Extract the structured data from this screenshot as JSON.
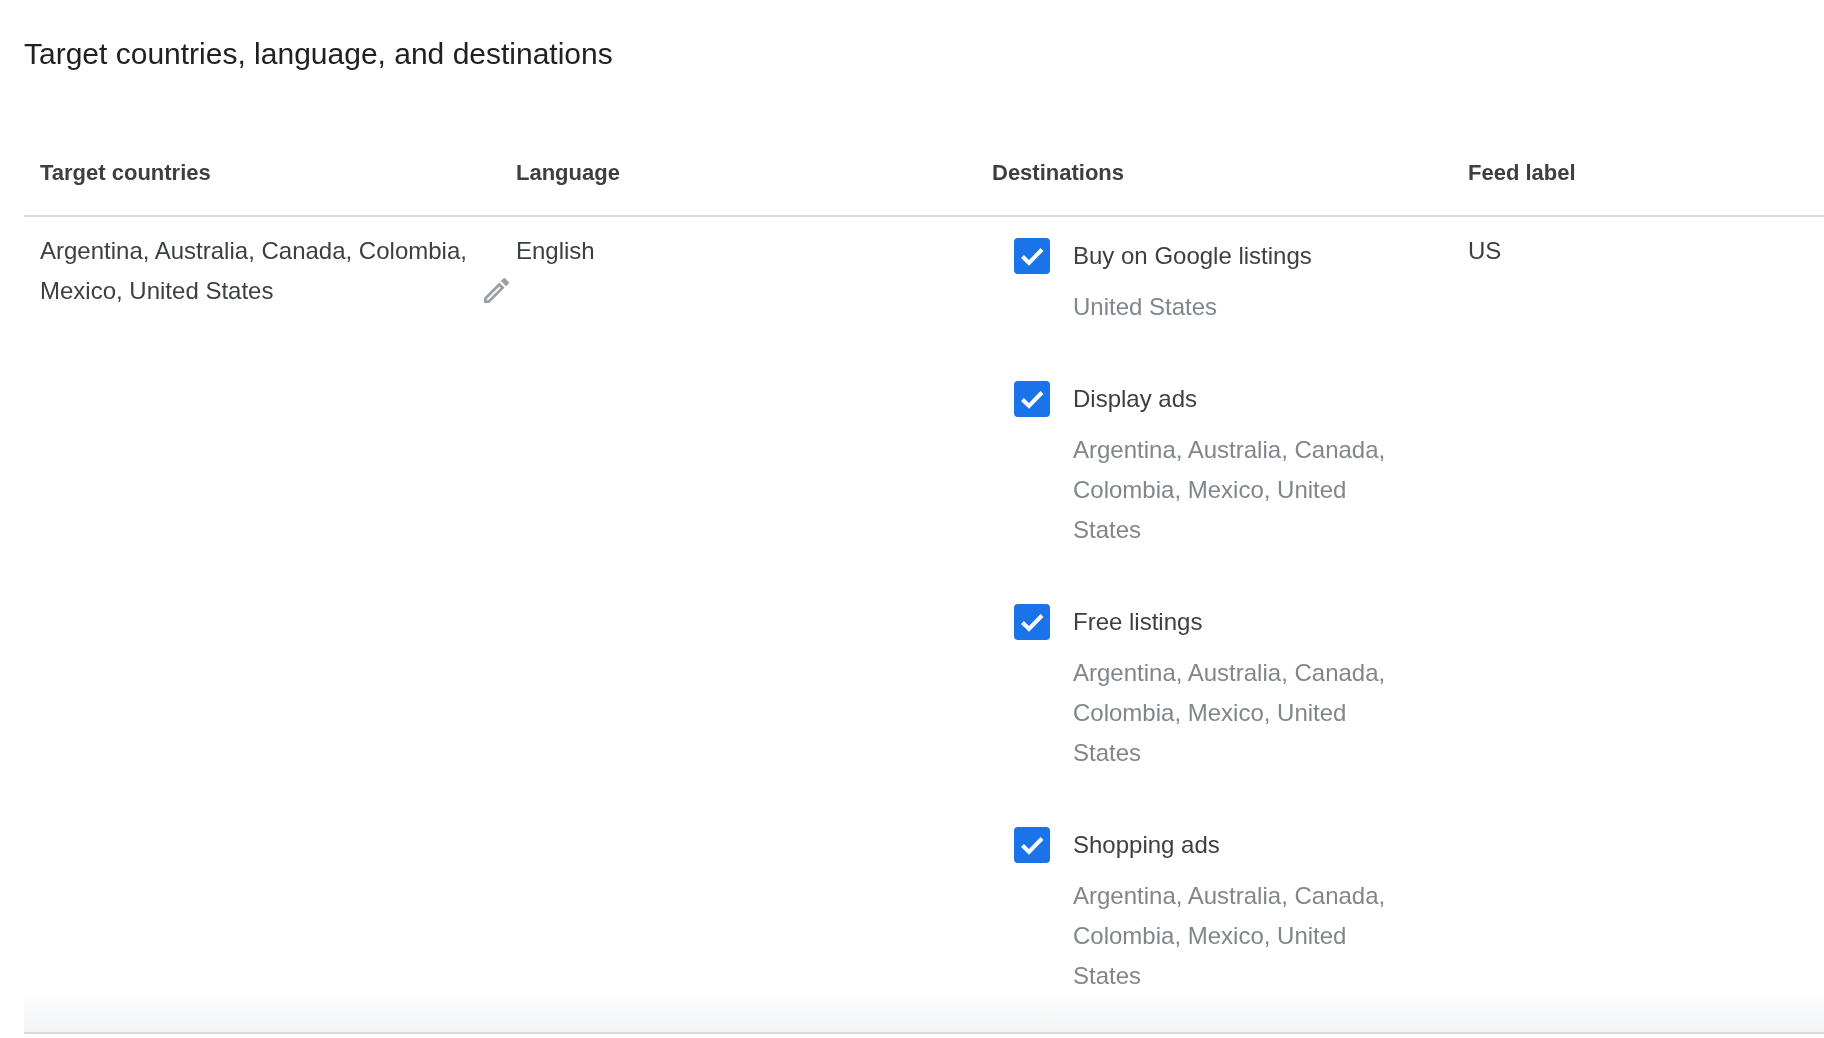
{
  "title": "Target countries, language, and destinations",
  "table": {
    "columns": [
      "Target countries",
      "Language",
      "Destinations",
      "Feed label"
    ],
    "rows": [
      {
        "target_countries": "Argentina, Australia, Canada, Colombia, Mexico, United States",
        "language": "English",
        "destinations": [
          {
            "label": "Buy on Google listings",
            "checked": true,
            "countries": "United States"
          },
          {
            "label": "Display ads",
            "checked": true,
            "countries": "Argentina, Australia, Canada, Colombia, Mexico, United States"
          },
          {
            "label": "Free listings",
            "checked": true,
            "countries": "Argentina, Australia, Canada, Colombia, Mexico, United States"
          },
          {
            "label": "Shopping ads",
            "checked": true,
            "countries": "Argentina, Australia, Canada, Colombia, Mexico, United States"
          }
        ],
        "feed_label": "US"
      }
    ]
  }
}
